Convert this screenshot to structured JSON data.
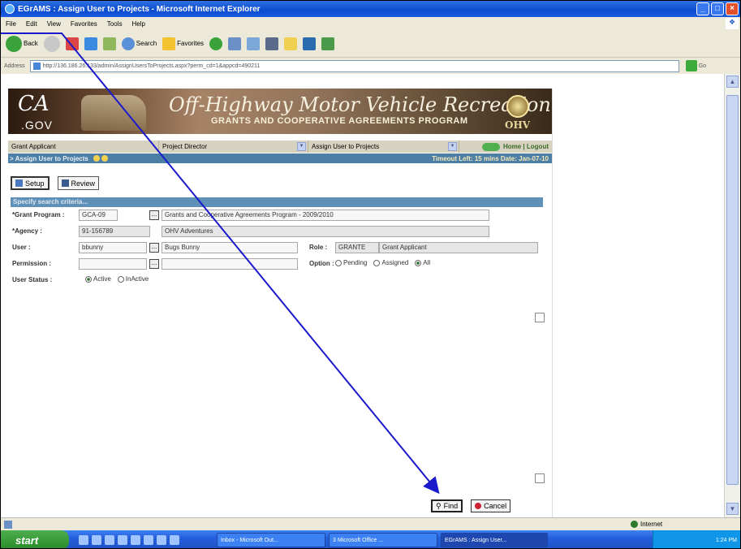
{
  "window": {
    "title": "EGrAMS : Assign User to Projects - Microsoft Internet Explorer"
  },
  "menu": [
    "File",
    "Edit",
    "View",
    "Favorites",
    "Tools",
    "Help"
  ],
  "toolbar": {
    "back": "Back",
    "search": "Search",
    "favorites": "Favorites"
  },
  "address": {
    "label": "Address",
    "url": "http://136.186.26.133/admin/AssignUsersToProjects.aspx?perm_cd=1&appcd=490211",
    "go": "Go"
  },
  "banner": {
    "logo_top": "CA",
    "logo_bottom": ".GOV",
    "title": "Off-Highway Motor Vehicle Recreation",
    "subtitle": "GRANTS AND COOPERATIVE AGREEMENTS PROGRAM",
    "badge": "OHV"
  },
  "nav": {
    "role": "Grant Applicant",
    "menu": "Project Director",
    "page": "Assign User to Projects",
    "home": "Home | Logout"
  },
  "subhead": {
    "title": "> Assign User to Projects",
    "status": "Timeout Left: 15 mins Date: Jan-07-10"
  },
  "tabs": {
    "setup": "Setup",
    "review": "Review"
  },
  "criteria": "Specify search criteria...",
  "form": {
    "grant_program_label": "*Grant Program :",
    "grant_program_code": "GCA-09",
    "grant_program_name": "Grants and Cooperative Agreements Program - 2009/2010",
    "agency_label": "*Agency :",
    "agency_code": "91-156789",
    "agency_name": "OHV Adventures",
    "user_label": "User :",
    "user_id": "bbunny",
    "user_name": "Bugs Bunny",
    "role_label": "Role :",
    "role_code": "GRANTE",
    "role_name": "Grant Applicant",
    "permission_label": "Permission :",
    "option_label": "Option :",
    "option_pending": "Pending",
    "option_assigned": "Assigned",
    "option_all": "All",
    "status_label": "User Status :",
    "status_active": "Active",
    "status_inactive": "InActive"
  },
  "actions": {
    "find": "Find",
    "cancel": "Cancel"
  },
  "status": {
    "zone": "Internet"
  },
  "taskbar": {
    "start": "start",
    "tasks": [
      "Inbox - Microsoft Out...",
      "3 Microsoft Office ...",
      "EGrAMS : Assign User..."
    ],
    "clock": "1:24 PM"
  },
  "colors": {
    "accent_line": "#1a1acc",
    "header_bar": "#4d7ea5",
    "title_bar": "#0a4bd0"
  }
}
